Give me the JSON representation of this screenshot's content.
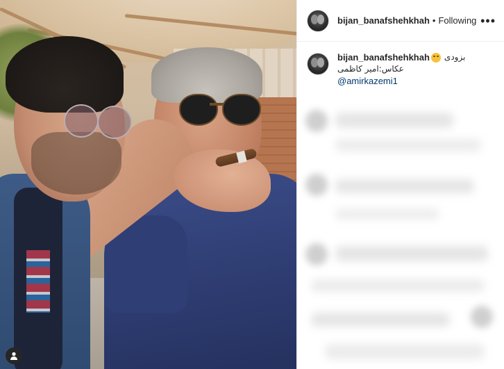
{
  "post": {
    "author": {
      "username": "bijan_banafshehkhah",
      "follow_state": "Following",
      "separator": "•"
    },
    "more_icon": "ellipsis-icon",
    "caption": {
      "username": "bijan_banafshehkhah",
      "text": "بزودی",
      "emoji": "winking-face",
      "line2": "عکاس:امیر کاظمی",
      "mention": "@amirkazemi1"
    },
    "photo": {
      "tag_icon": "user-tag-icon"
    }
  },
  "colors": {
    "text": "#262626",
    "link": "#00376b",
    "border": "#efefef",
    "shirt": "#2c3a6e",
    "jacket": "#3d5b86"
  }
}
